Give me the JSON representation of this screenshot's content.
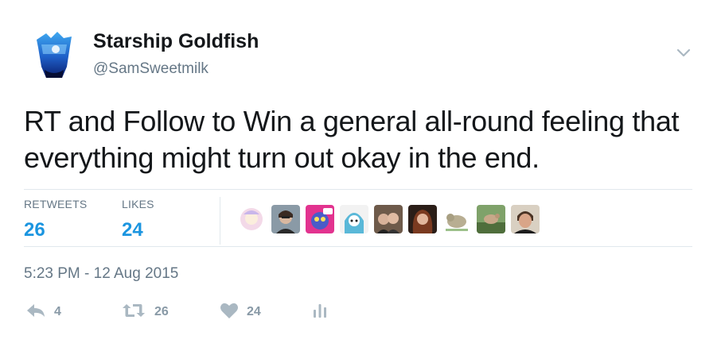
{
  "author": {
    "name": "Starship Goldfish",
    "handle": "@SamSweetmilk"
  },
  "tweet": {
    "text": "RT and Follow to Win a general all-round feeling that everything might turn out okay in the end."
  },
  "stats": {
    "retweets_label": "RETWEETS",
    "retweets_value": "26",
    "likes_label": "LIKES",
    "likes_value": "24"
  },
  "timestamp": "5:23 PM - 12 Aug 2015",
  "actions": {
    "reply_count": "4",
    "retweet_count": "26",
    "like_count": "24"
  },
  "icons": {
    "caret": "chevron-down-icon",
    "reply": "reply-icon",
    "retweet": "retweet-icon",
    "like": "heart-icon",
    "analytics": "analytics-icon"
  },
  "colors": {
    "accent": "#1b95e0",
    "text": "#14171a",
    "muted": "#657786",
    "action_icon": "#aab8c2",
    "divider": "#e1e8ed"
  }
}
